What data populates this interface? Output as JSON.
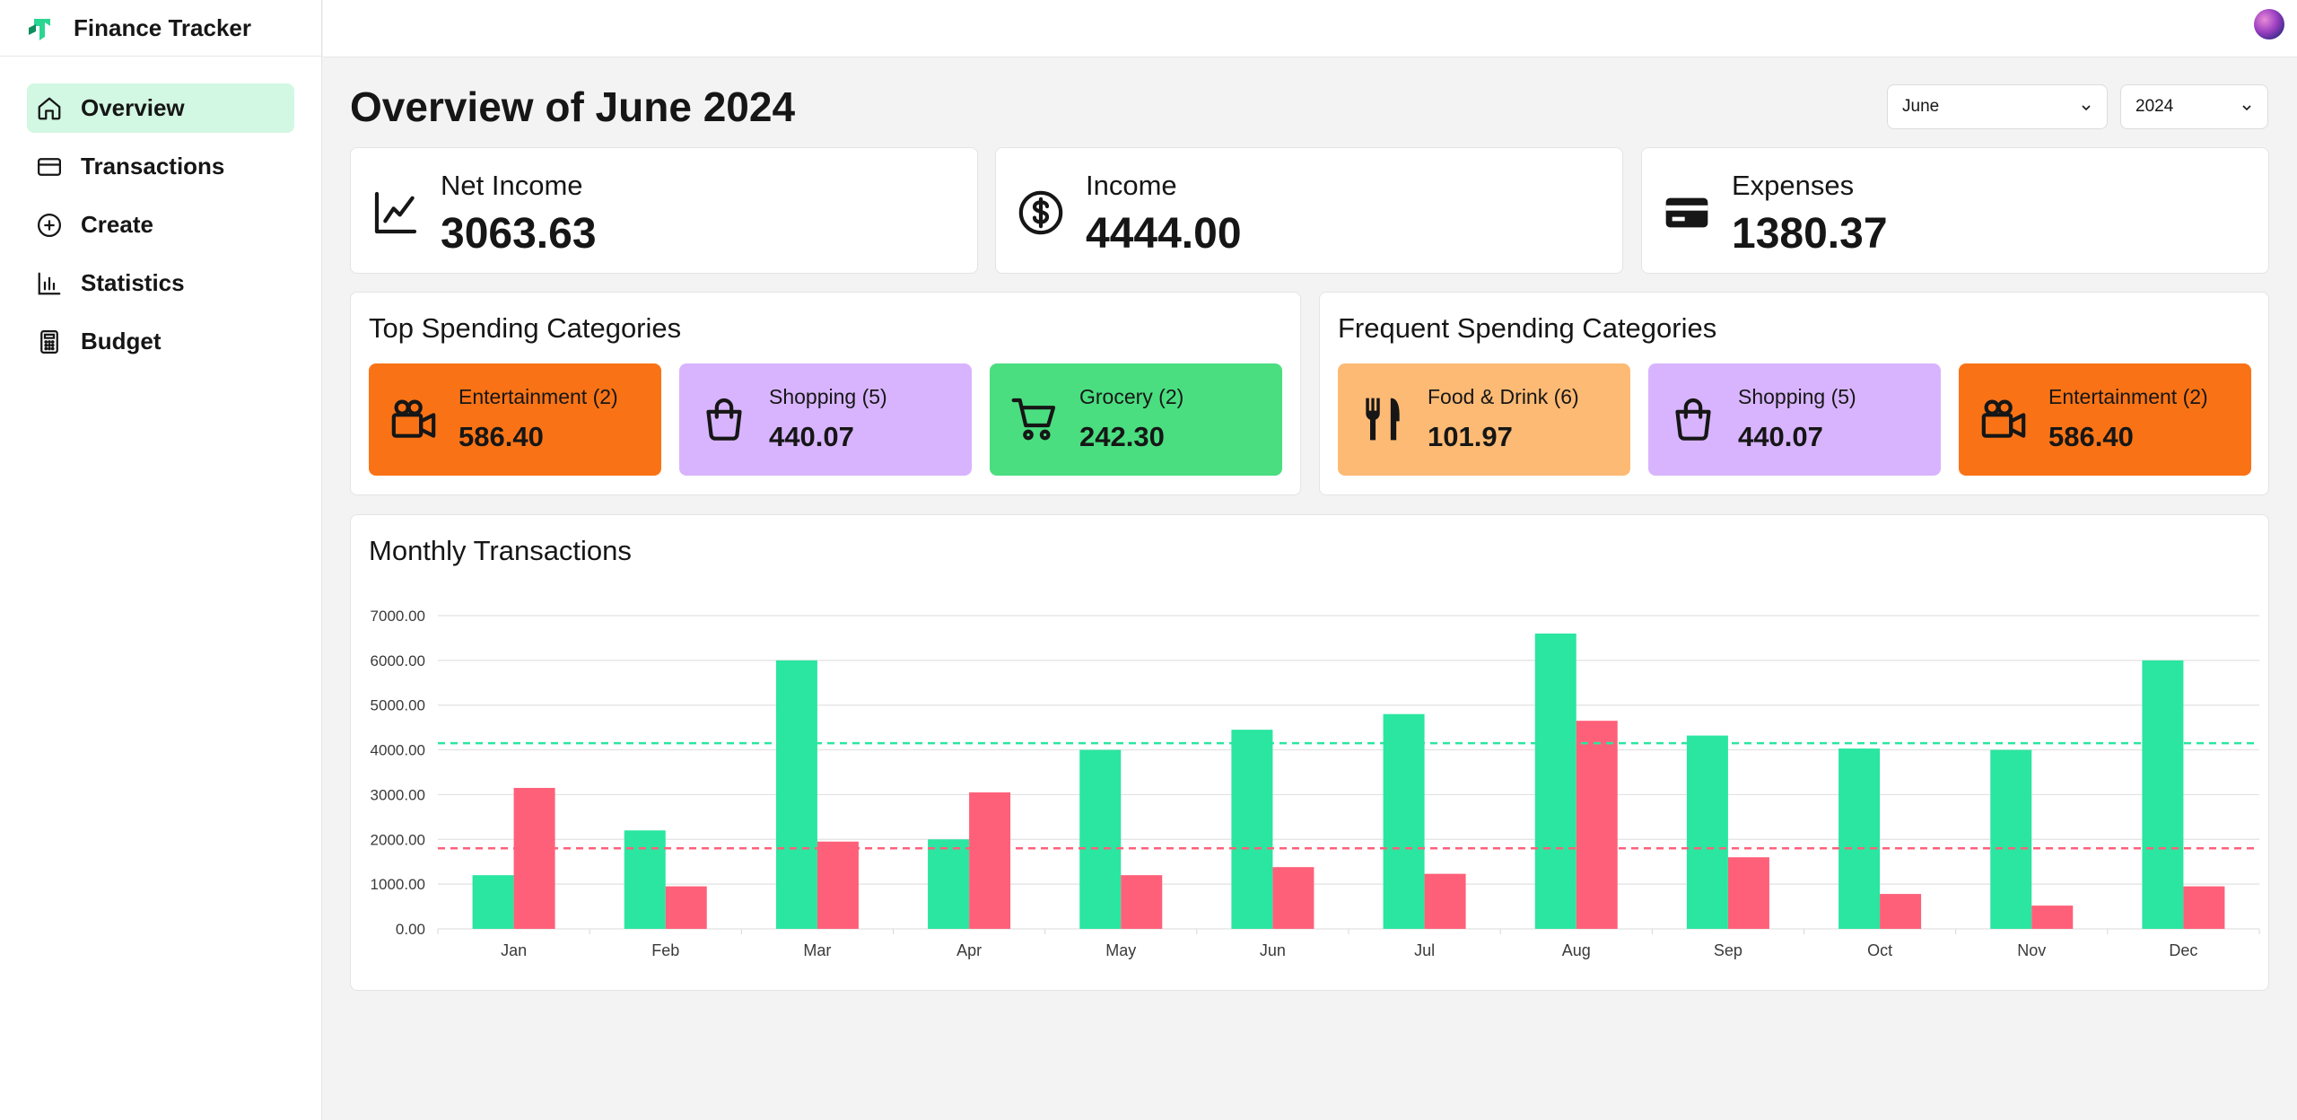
{
  "app": {
    "name": "Finance Tracker"
  },
  "sidebar": {
    "items": [
      {
        "label": "Overview",
        "icon": "home-icon",
        "active": true
      },
      {
        "label": "Transactions",
        "icon": "credit-card-icon",
        "active": false
      },
      {
        "label": "Create",
        "icon": "plus-circle-icon",
        "active": false
      },
      {
        "label": "Statistics",
        "icon": "bar-chart-icon",
        "active": false
      },
      {
        "label": "Budget",
        "icon": "calculator-icon",
        "active": false
      }
    ]
  },
  "header": {
    "title": "Overview of June 2024",
    "month_select": "June",
    "year_select": "2024"
  },
  "stats": {
    "net_income": {
      "label": "Net Income",
      "value": "3063.63",
      "icon": "line-chart-icon"
    },
    "income": {
      "label": "Income",
      "value": "4444.00",
      "icon": "dollar-circle-icon"
    },
    "expenses": {
      "label": "Expenses",
      "value": "1380.37",
      "icon": "credit-card-icon"
    }
  },
  "top_spending": {
    "title": "Top Spending Categories",
    "items": [
      {
        "label": "Entertainment (2)",
        "value": "586.40",
        "color": "#f97316",
        "icon": "video-camera-icon"
      },
      {
        "label": "Shopping (5)",
        "value": "440.07",
        "color": "#d8b4fe",
        "icon": "shopping-bag-icon"
      },
      {
        "label": "Grocery (2)",
        "value": "242.30",
        "color": "#4ade80",
        "icon": "shopping-cart-icon"
      }
    ]
  },
  "frequent_spending": {
    "title": "Frequent Spending Categories",
    "items": [
      {
        "label": "Food & Drink (6)",
        "value": "101.97",
        "color": "#fdba74",
        "icon": "fork-knife-icon"
      },
      {
        "label": "Shopping (5)",
        "value": "440.07",
        "color": "#d8b4fe",
        "icon": "shopping-bag-icon"
      },
      {
        "label": "Entertainment (2)",
        "value": "586.40",
        "color": "#f97316",
        "icon": "video-camera-icon"
      }
    ]
  },
  "monthly": {
    "title": "Monthly Transactions"
  },
  "colors": {
    "accent": "#d2f7e2",
    "income": "#2ae6a0",
    "expense": "#ff6079"
  },
  "chart_data": {
    "type": "bar",
    "categories": [
      "Jan",
      "Feb",
      "Mar",
      "Apr",
      "May",
      "Jun",
      "Jul",
      "Aug",
      "Sep",
      "Oct",
      "Nov",
      "Dec"
    ],
    "series": [
      {
        "values": [
          1200,
          2200,
          6000,
          2000,
          4000,
          4450,
          4800,
          6600,
          4320,
          4030,
          4000,
          6000
        ],
        "color": "#2ae6a0"
      },
      {
        "values": [
          3150,
          950,
          1950,
          3050,
          1200,
          1380,
          1230,
          4650,
          1600,
          780,
          520,
          950
        ],
        "color": "#ff6079"
      }
    ],
    "reference_lines": [
      {
        "value": 4150,
        "color": "#2ae6a0",
        "style": "dashed"
      },
      {
        "value": 1800,
        "color": "#ff6079",
        "style": "dashed"
      }
    ],
    "yticks": [
      "0.00",
      "1000.00",
      "2000.00",
      "3000.00",
      "4000.00",
      "5000.00",
      "6000.00",
      "7000.00"
    ],
    "ylim": [
      0,
      7000
    ],
    "grid": true
  }
}
